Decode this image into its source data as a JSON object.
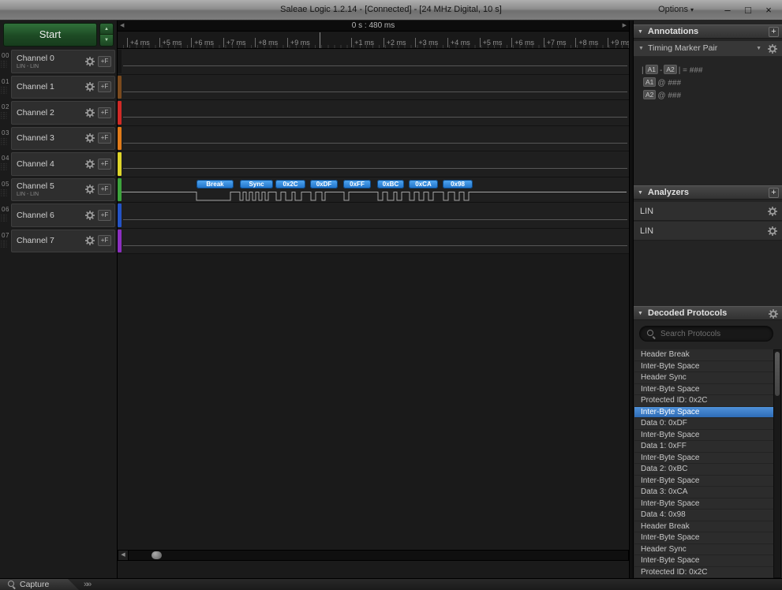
{
  "titlebar": {
    "title": "Saleae Logic 1.2.14 - [Connected] - [24 MHz Digital, 10 s]",
    "options_label": "Options",
    "window_controls": {
      "minimize": "–",
      "maximize": "□",
      "close": "×"
    }
  },
  "toolbar": {
    "start_label": "Start",
    "channel_trigger_label": "+F"
  },
  "channels": [
    {
      "num": "00",
      "label": "Channel 0",
      "sublabel": "LIN - LIN",
      "color": "#161616"
    },
    {
      "num": "01",
      "label": "Channel 1",
      "sublabel": "",
      "color": "#7a4a1e"
    },
    {
      "num": "02",
      "label": "Channel 2",
      "sublabel": "",
      "color": "#cf2a27"
    },
    {
      "num": "03",
      "label": "Channel 3",
      "sublabel": "",
      "color": "#e07b1a"
    },
    {
      "num": "04",
      "label": "Channel 4",
      "sublabel": "",
      "color": "#ded52b"
    },
    {
      "num": "05",
      "label": "Channel 5",
      "sublabel": "LIN - LIN",
      "color": "#3da33c"
    },
    {
      "num": "06",
      "label": "Channel 6",
      "sublabel": "",
      "color": "#2453c5"
    },
    {
      "num": "07",
      "label": "Channel 7",
      "sublabel": "",
      "color": "#8c2fc0"
    }
  ],
  "timeline": {
    "major_label": "0 s : 480 ms",
    "ticks": [
      "+4 ms",
      "+5 ms",
      "+6 ms",
      "+7 ms",
      "+8 ms",
      "+9 ms",
      "",
      "+1 ms",
      "+2 ms",
      "+3 ms",
      "+4 ms",
      "+5 ms",
      "+6 ms",
      "+7 ms",
      "+8 ms",
      "+9 ms"
    ]
  },
  "decode_bubbles": [
    "Break",
    "Sync",
    "0x2C",
    "0xDF",
    "0xFF",
    "0xBC",
    "0xCA",
    "0x98"
  ],
  "annotations_panel": {
    "title": "Annotations",
    "add_label": "+",
    "marker": {
      "title": "Timing Marker Pair",
      "pair_prefix": "|",
      "a1_label": "A1",
      "pair_sep": "-",
      "a2_label": "A2",
      "pair_suffix": "| = ###",
      "at_value": "@ ###"
    }
  },
  "analyzers_panel": {
    "title": "Analyzers",
    "add_label": "+",
    "items": [
      "LIN",
      "LIN"
    ]
  },
  "protocols_panel": {
    "title": "Decoded Protocols",
    "search_placeholder": "Search Protocols",
    "selected_index": 5,
    "items": [
      "Header Break",
      "Inter-Byte Space",
      "Header Sync",
      "Inter-Byte Space",
      "Protected ID: 0x2C",
      "Inter-Byte Space",
      "Data 0: 0xDF",
      "Inter-Byte Space",
      "Data 1: 0xFF",
      "Inter-Byte Space",
      "Data 2: 0xBC",
      "Inter-Byte Space",
      "Data 3: 0xCA",
      "Inter-Byte Space",
      "Data 4: 0x98",
      "Header Break",
      "Inter-Byte Space",
      "Header Sync",
      "Inter-Byte Space",
      "Protected ID: 0x2C"
    ]
  },
  "statusbar": {
    "capture_label": "Capture"
  },
  "colors": {
    "selection_blue": "#3c7dc4",
    "bubble_blue": "#2b86dd",
    "start_green": "#1e4f27"
  }
}
